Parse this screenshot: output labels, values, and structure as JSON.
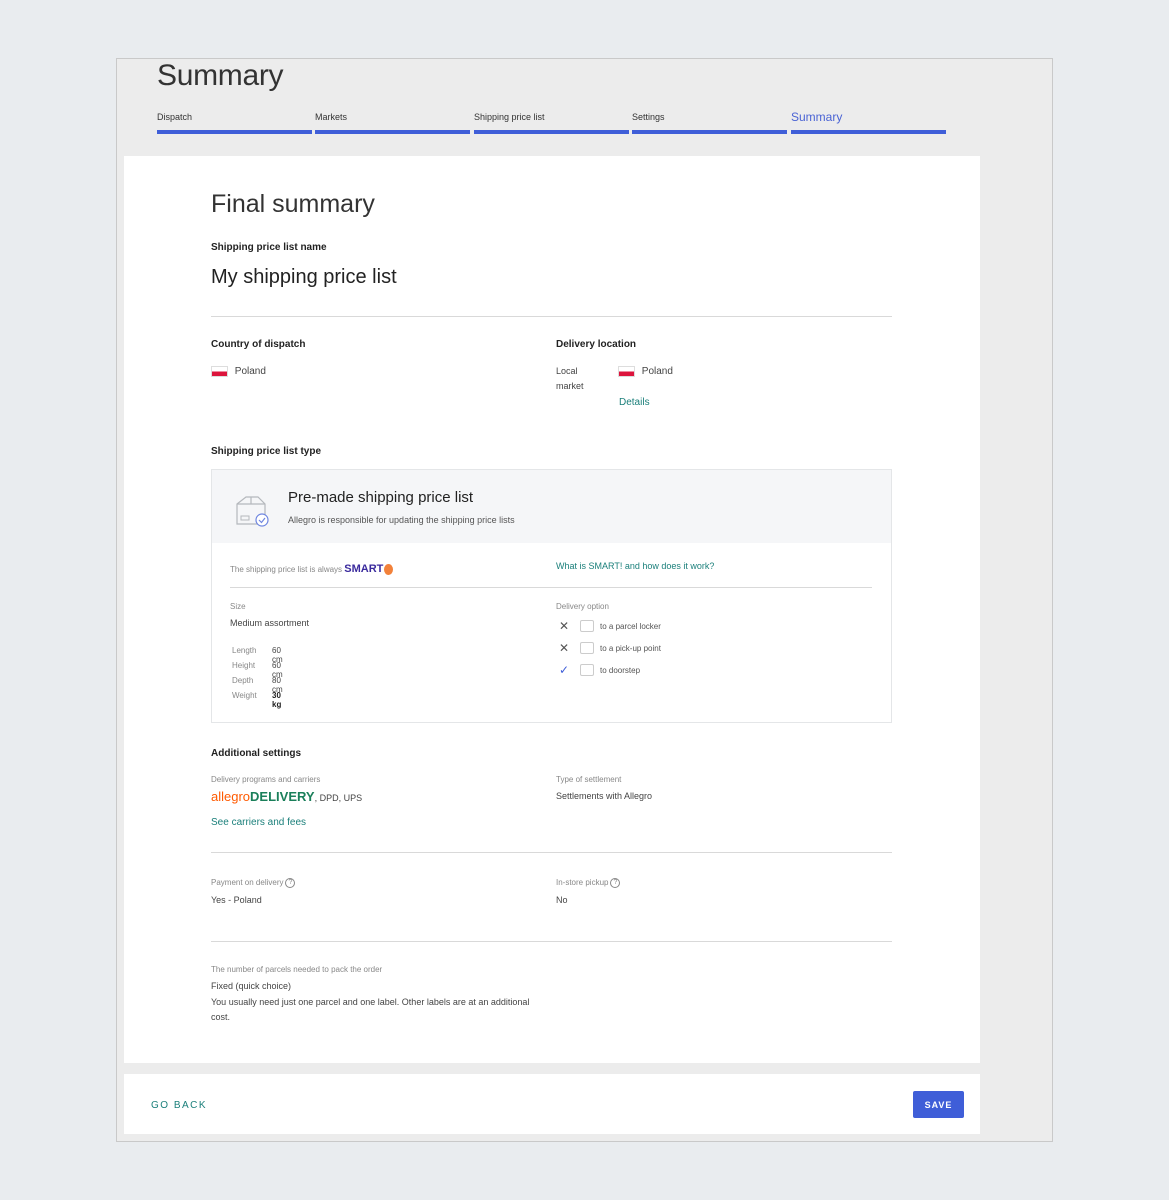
{
  "header": {
    "title": "Summary"
  },
  "steps": [
    {
      "label": "Dispatch",
      "active": false
    },
    {
      "label": "Markets",
      "active": false
    },
    {
      "label": "Shipping price list",
      "active": false
    },
    {
      "label": "Settings",
      "active": false
    },
    {
      "label": "Summary",
      "active": true
    }
  ],
  "summary": {
    "title": "Final summary",
    "name_label": "Shipping price list name",
    "name_value": "My shipping price list",
    "country_label": "Country of dispatch",
    "country_value": "Poland",
    "delivery_label": "Delivery location",
    "delivery_market_label": "Local market",
    "delivery_country": "Poland",
    "details_link": "Details",
    "type_label": "Shipping price list type"
  },
  "type_box": {
    "title": "Pre-made shipping price list",
    "subtitle": "Allegro is responsible for updating the shipping price lists",
    "smart_prefix": "The shipping price list is always",
    "smart_badge": "SMART",
    "smart_link": "What is SMART! and how does it work?",
    "size_label": "Size",
    "size_value": "Medium assortment",
    "dimensions": [
      {
        "key": "Length",
        "value": "60 cm",
        "bold": false
      },
      {
        "key": "Height",
        "value": "60 cm",
        "bold": false
      },
      {
        "key": "Depth",
        "value": "80 cm",
        "bold": false
      },
      {
        "key": "Weight",
        "value": "30 kg",
        "bold": true
      }
    ],
    "delivery_option_label": "Delivery option",
    "delivery_options": [
      {
        "label": "to a parcel locker",
        "enabled": false
      },
      {
        "label": "to a pick-up point",
        "enabled": false
      },
      {
        "label": "to doorstep",
        "enabled": true
      }
    ]
  },
  "additional": {
    "title": "Additional settings",
    "programs_label": "Delivery programs and carriers",
    "allegro": "allegro",
    "delivery": "DELIVERY",
    "carriers_suffix": ", DPD, UPS",
    "carriers_link": "See carriers and fees",
    "settlement_label": "Type of settlement",
    "settlement_value": "Settlements with Allegro",
    "cod_label": "Payment on delivery",
    "cod_value": "Yes - Poland",
    "pickup_label": "In-store pickup",
    "pickup_value": "No",
    "parcels_label": "The number of parcels needed to pack the order",
    "parcels_value": "Fixed (quick choice)",
    "parcels_note": "You usually need just one parcel and one label. Other labels are at an additional cost."
  },
  "footer": {
    "back_label": "GO BACK",
    "save_label": "SAVE"
  },
  "colors": {
    "accent": "#3f5ed8",
    "link": "#1a7f7a",
    "allegro_orange": "#ff5a00",
    "smart_purple": "#3a2a9d"
  }
}
